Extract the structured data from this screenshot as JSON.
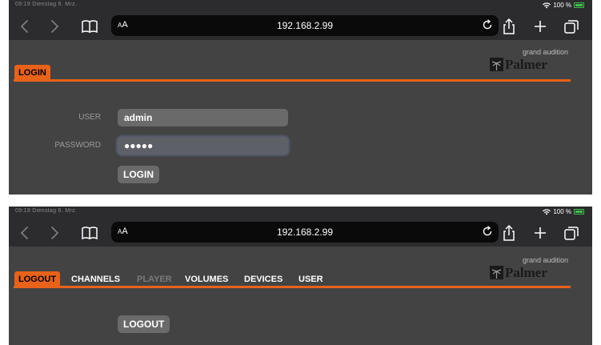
{
  "status_bar": {
    "time_date": "09:19 Dienstag 6. Mrz.",
    "battery": "100 %"
  },
  "browser": {
    "text_size_label": "AA",
    "address": "192.168.2.99",
    "icons": [
      "back-icon",
      "forward-icon",
      "book-icon",
      "reload-icon",
      "share-icon",
      "plus-icon",
      "tabs-icon"
    ]
  },
  "brand": {
    "tagline": "grand audition",
    "name": "Palmer",
    "accent_color": "#e8621a"
  },
  "login_screen": {
    "tab": "LOGIN",
    "user_label": "USER",
    "user_value": "admin",
    "password_label": "PASSWORD",
    "password_value": "●●●●●",
    "login_button": "LOGIN"
  },
  "main_screen": {
    "nav": [
      {
        "label": "LOGOUT",
        "state": "active"
      },
      {
        "label": "CHANNELS",
        "state": "normal"
      },
      {
        "label": "PLAYER",
        "state": "disabled"
      },
      {
        "label": "VOLUMES",
        "state": "normal"
      },
      {
        "label": "DEVICES",
        "state": "normal"
      },
      {
        "label": "USER",
        "state": "normal"
      }
    ],
    "logout_button": "LOGOUT"
  }
}
